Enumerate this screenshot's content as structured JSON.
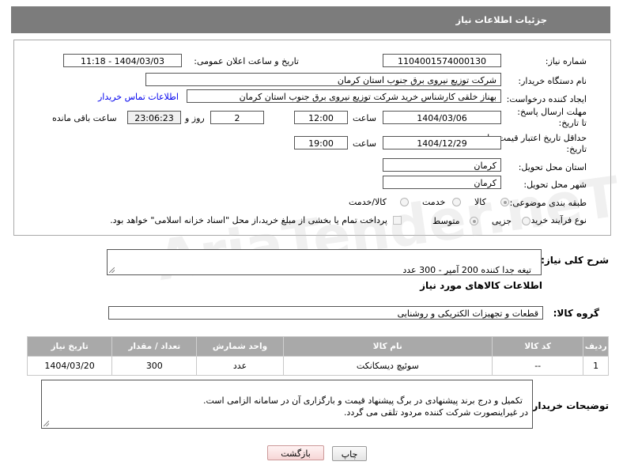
{
  "header": {
    "title": "جزئیات اطلاعات نیاز"
  },
  "form": {
    "need_number_label": "شماره نیاز:",
    "need_number": "1104001574000130",
    "announce_label": "تاریخ و ساعت اعلان عمومی:",
    "announce_value": "1404/03/03 - 11:18",
    "buyer_org_label": "نام دستگاه خریدار:",
    "buyer_org": "شرکت توزیع نیروی برق جنوب استان کرمان",
    "creator_label": "ایجاد کننده درخواست:",
    "creator": "بهناز خلقی کارشناس خرید شرکت توزیع نیروی برق جنوب استان کرمان",
    "contact_link": "اطلاعات تماس خریدار",
    "deadline_label": "مهلت ارسال پاسخ: تا تاریخ:",
    "deadline_date": "1404/03/06",
    "time_label": "ساعت",
    "deadline_time": "12:00",
    "days_value": "2",
    "days_label": "روز و",
    "remaining_time": "23:06:23",
    "remaining_label": "ساعت باقی مانده",
    "validity_label": "حداقل تاریخ اعتبار قیمت: تا تاریخ:",
    "validity_date": "1404/12/29",
    "validity_time": "19:00",
    "province_label": "استان محل تحویل:",
    "province": "کرمان",
    "city_label": "شهر محل تحویل:",
    "city": "کرمان",
    "category_label": "طبقه بندی موضوعی:",
    "category_options": [
      "کالا",
      "خدمت",
      "کالا/خدمت"
    ],
    "process_label": "نوع فرآیند خرید :",
    "process_options": [
      "جزیی",
      "متوسط"
    ],
    "payment_note": "پرداخت تمام یا بخشی از مبلغ خرید،از محل \"اسناد خزانه اسلامی\" خواهد بود."
  },
  "summary": {
    "label": "شرح کلی نیاز:",
    "value": "تیغه جدا کننده 200 آمپر - 300 عدد"
  },
  "goods": {
    "section_title": "اطلاعات کالاهای مورد نیاز",
    "group_label": "گروه کالا:",
    "group_value": "قطعات و تجهیزات الکتریکی و روشنایی",
    "columns": [
      "ردیف",
      "کد کالا",
      "نام کالا",
      "واحد شمارش",
      "تعداد / مقدار",
      "تاریخ نیاز"
    ],
    "rows": [
      [
        "1",
        "--",
        "سوئیچ دیسکانکت",
        "عدد",
        "300",
        "1404/03/20"
      ]
    ]
  },
  "buyer_notes": {
    "label": "توضیحات خریدار:",
    "text": "تکمیل و درج برند پیشنهادی در برگ پیشنهاد قیمت و بارگزاری آن در سامانه الزامی است.\nدر غیراینصورت شرکت کننده مردود تلقی می گردد."
  },
  "buttons": {
    "print": "چاپ",
    "back": "بازگشت"
  },
  "watermark": "AriaTender.neT"
}
